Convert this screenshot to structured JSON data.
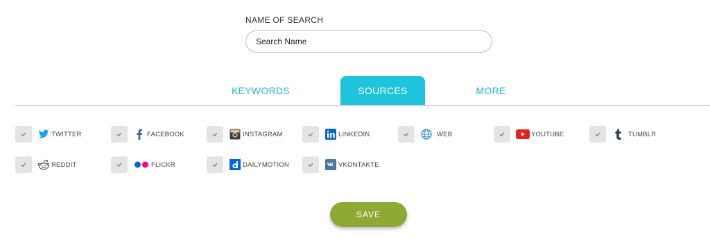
{
  "search": {
    "label": "NAME OF SEARCH",
    "placeholder": "Search Name"
  },
  "tabs": [
    {
      "label": "KEYWORDS",
      "active": false
    },
    {
      "label": "SOURCES",
      "active": true
    },
    {
      "label": "MORE",
      "active": false
    }
  ],
  "sources": [
    {
      "label": "TWITTER",
      "icon": "twitter-icon",
      "checked": true
    },
    {
      "label": "FACEBOOK",
      "icon": "facebook-icon",
      "checked": true
    },
    {
      "label": "INSTAGRAM",
      "icon": "instagram-icon",
      "checked": true
    },
    {
      "label": "LINKEDIN",
      "icon": "linkedin-icon",
      "checked": true
    },
    {
      "label": "WEB",
      "icon": "globe-icon",
      "checked": true
    },
    {
      "label": "YOUTUBE",
      "icon": "youtube-icon",
      "checked": true
    },
    {
      "label": "TUMBLR",
      "icon": "tumblr-icon",
      "checked": true
    },
    {
      "label": "REDDIT",
      "icon": "reddit-icon",
      "checked": true
    },
    {
      "label": "FLICKR",
      "icon": "flickr-icon",
      "checked": true
    },
    {
      "label": "DAILYMOTION",
      "icon": "dailymotion-icon",
      "checked": true
    },
    {
      "label": "VKONTAKTE",
      "icon": "vkontakte-icon",
      "checked": true
    }
  ],
  "actions": {
    "save_label": "SAVE"
  },
  "colors": {
    "accent": "#1ec3dd",
    "tab_text": "#27b6d3",
    "save": "#8ea936",
    "checkbox_bg": "#e4e4e4"
  }
}
